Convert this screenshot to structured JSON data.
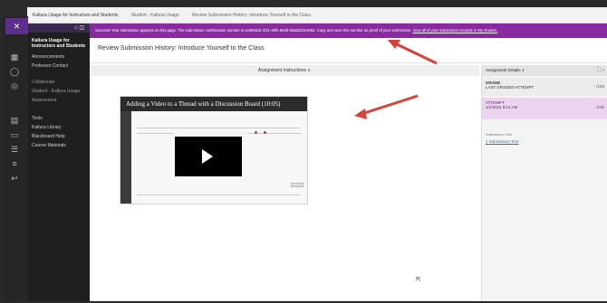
{
  "browser_tabs": [
    "Kaltura Usage for Instructors and Students",
    "Student - Kaltura Usage",
    "Review Submission History: Introduce Yourself to the Class"
  ],
  "sidebar": {
    "course_title": "Kaltura Usage for Instructors and Students",
    "items": [
      "Announcements",
      "Professor Contact",
      "Collaborate",
      "Student - Kaltura Usage",
      "Assessment",
      "Tools",
      "Kaltura Library",
      "Blackboard Help",
      "Course Materials"
    ]
  },
  "banner": {
    "text": "Success! Your submission appears on this page. The submission confirmation number is ce0056cb-1f21-48f1-8ed0-9dab220e4062. Copy and save this number as proof of your submission.",
    "link": "View all of your submission receipts in My Grades."
  },
  "page": {
    "title": "Review Submission History: Introduce Yourself to the Class",
    "instructions_label": "Assignment Instructions ∨"
  },
  "video": {
    "title": "Adding a Video to a Thread with a Discussion Board (10:05)"
  },
  "details_panel": {
    "header": "Assignment Details ∨",
    "grade_label": "GRADE",
    "grade_sub": "LAST GRADED ATTEMPT",
    "grade_value": "- /100",
    "attempt_label": "ATTEMPT",
    "attempt_sub": "1/1/2021 8:14 AM",
    "attempt_value": "- /100",
    "submission_label": "Submission Text",
    "submission_link": "Submission Text"
  },
  "colors": {
    "banner": "#8a2aa0",
    "attempt_highlight": "#ecd4ef",
    "arrow": "#d9403a"
  }
}
